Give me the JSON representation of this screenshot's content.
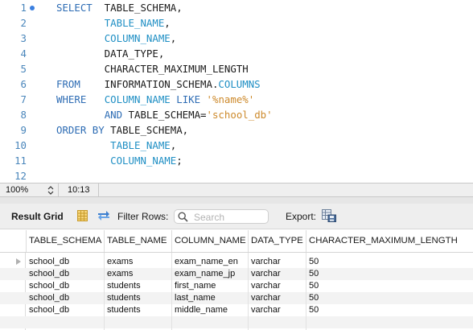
{
  "editor": {
    "lines": [
      {
        "n": "1",
        "tokens": [
          {
            "t": "SELECT",
            "c": "kw"
          },
          {
            "t": "  TABLE_SCHEMA,",
            "c": ""
          }
        ]
      },
      {
        "n": "2",
        "tokens": [
          {
            "t": "        ",
            "c": ""
          },
          {
            "t": "TABLE_NAME",
            "c": "id"
          },
          {
            "t": ",",
            "c": ""
          }
        ]
      },
      {
        "n": "3",
        "tokens": [
          {
            "t": "        ",
            "c": ""
          },
          {
            "t": "COLUMN_NAME",
            "c": "id"
          },
          {
            "t": ",",
            "c": ""
          }
        ]
      },
      {
        "n": "4",
        "tokens": [
          {
            "t": "        DATA_TYPE,",
            "c": ""
          }
        ]
      },
      {
        "n": "5",
        "tokens": [
          {
            "t": "        CHARACTER_MAXIMUM_LENGTH",
            "c": ""
          }
        ]
      },
      {
        "n": "6",
        "tokens": [
          {
            "t": "FROM",
            "c": "kw"
          },
          {
            "t": "    INFORMATION_SCHEMA.",
            "c": ""
          },
          {
            "t": "COLUMNS",
            "c": "id"
          }
        ]
      },
      {
        "n": "7",
        "tokens": [
          {
            "t": "WHERE",
            "c": "kw"
          },
          {
            "t": "   ",
            "c": ""
          },
          {
            "t": "COLUMN_NAME",
            "c": "id"
          },
          {
            "t": " ",
            "c": ""
          },
          {
            "t": "LIKE",
            "c": "kw"
          },
          {
            "t": " ",
            "c": ""
          },
          {
            "t": "'%name%'",
            "c": "str"
          }
        ]
      },
      {
        "n": "8",
        "tokens": [
          {
            "t": "        ",
            "c": ""
          },
          {
            "t": "AND",
            "c": "kw"
          },
          {
            "t": " TABLE_SCHEMA=",
            "c": ""
          },
          {
            "t": "'school_db'",
            "c": "str"
          }
        ]
      },
      {
        "n": "9",
        "tokens": [
          {
            "t": "ORDER BY",
            "c": "kw"
          },
          {
            "t": " TABLE_SCHEMA,",
            "c": ""
          }
        ]
      },
      {
        "n": "10",
        "tokens": [
          {
            "t": "         ",
            "c": ""
          },
          {
            "t": "TABLE_NAME",
            "c": "id"
          },
          {
            "t": ",",
            "c": ""
          }
        ]
      },
      {
        "n": "11",
        "tokens": [
          {
            "t": "         ",
            "c": ""
          },
          {
            "t": "COLUMN_NAME",
            "c": "id"
          },
          {
            "t": ";",
            "c": ""
          }
        ]
      },
      {
        "n": "12",
        "tokens": []
      }
    ],
    "active_line": "1",
    "colors": {
      "keyword": "#2d6cb4",
      "identifier": "#1f8fc4",
      "string": "#cd8a2c",
      "line_number": "#4a86bb"
    }
  },
  "statusbar": {
    "zoom": "100%",
    "cursor": "10:13"
  },
  "result_toolbar": {
    "title": "Result Grid",
    "grid_icon": "result-grid-icon",
    "refresh_icon": "refresh-icon",
    "filter_label": "Filter Rows:",
    "search_placeholder": "Search",
    "search_value": "",
    "export_label": "Export:",
    "export_icon": "export-icon"
  },
  "grid": {
    "columns": [
      "TABLE_SCHEMA",
      "TABLE_NAME",
      "COLUMN_NAME",
      "DATA_TYPE",
      "CHARACTER_MAXIMUM_LENGTH"
    ],
    "rows": [
      [
        "school_db",
        "exams",
        "exam_name_en",
        "varchar",
        "50"
      ],
      [
        "school_db",
        "exams",
        "exam_name_jp",
        "varchar",
        "50"
      ],
      [
        "school_db",
        "students",
        "first_name",
        "varchar",
        "50"
      ],
      [
        "school_db",
        "students",
        "last_name",
        "varchar",
        "50"
      ],
      [
        "school_db",
        "students",
        "middle_name",
        "varchar",
        "50"
      ]
    ],
    "selected_row": 0
  }
}
